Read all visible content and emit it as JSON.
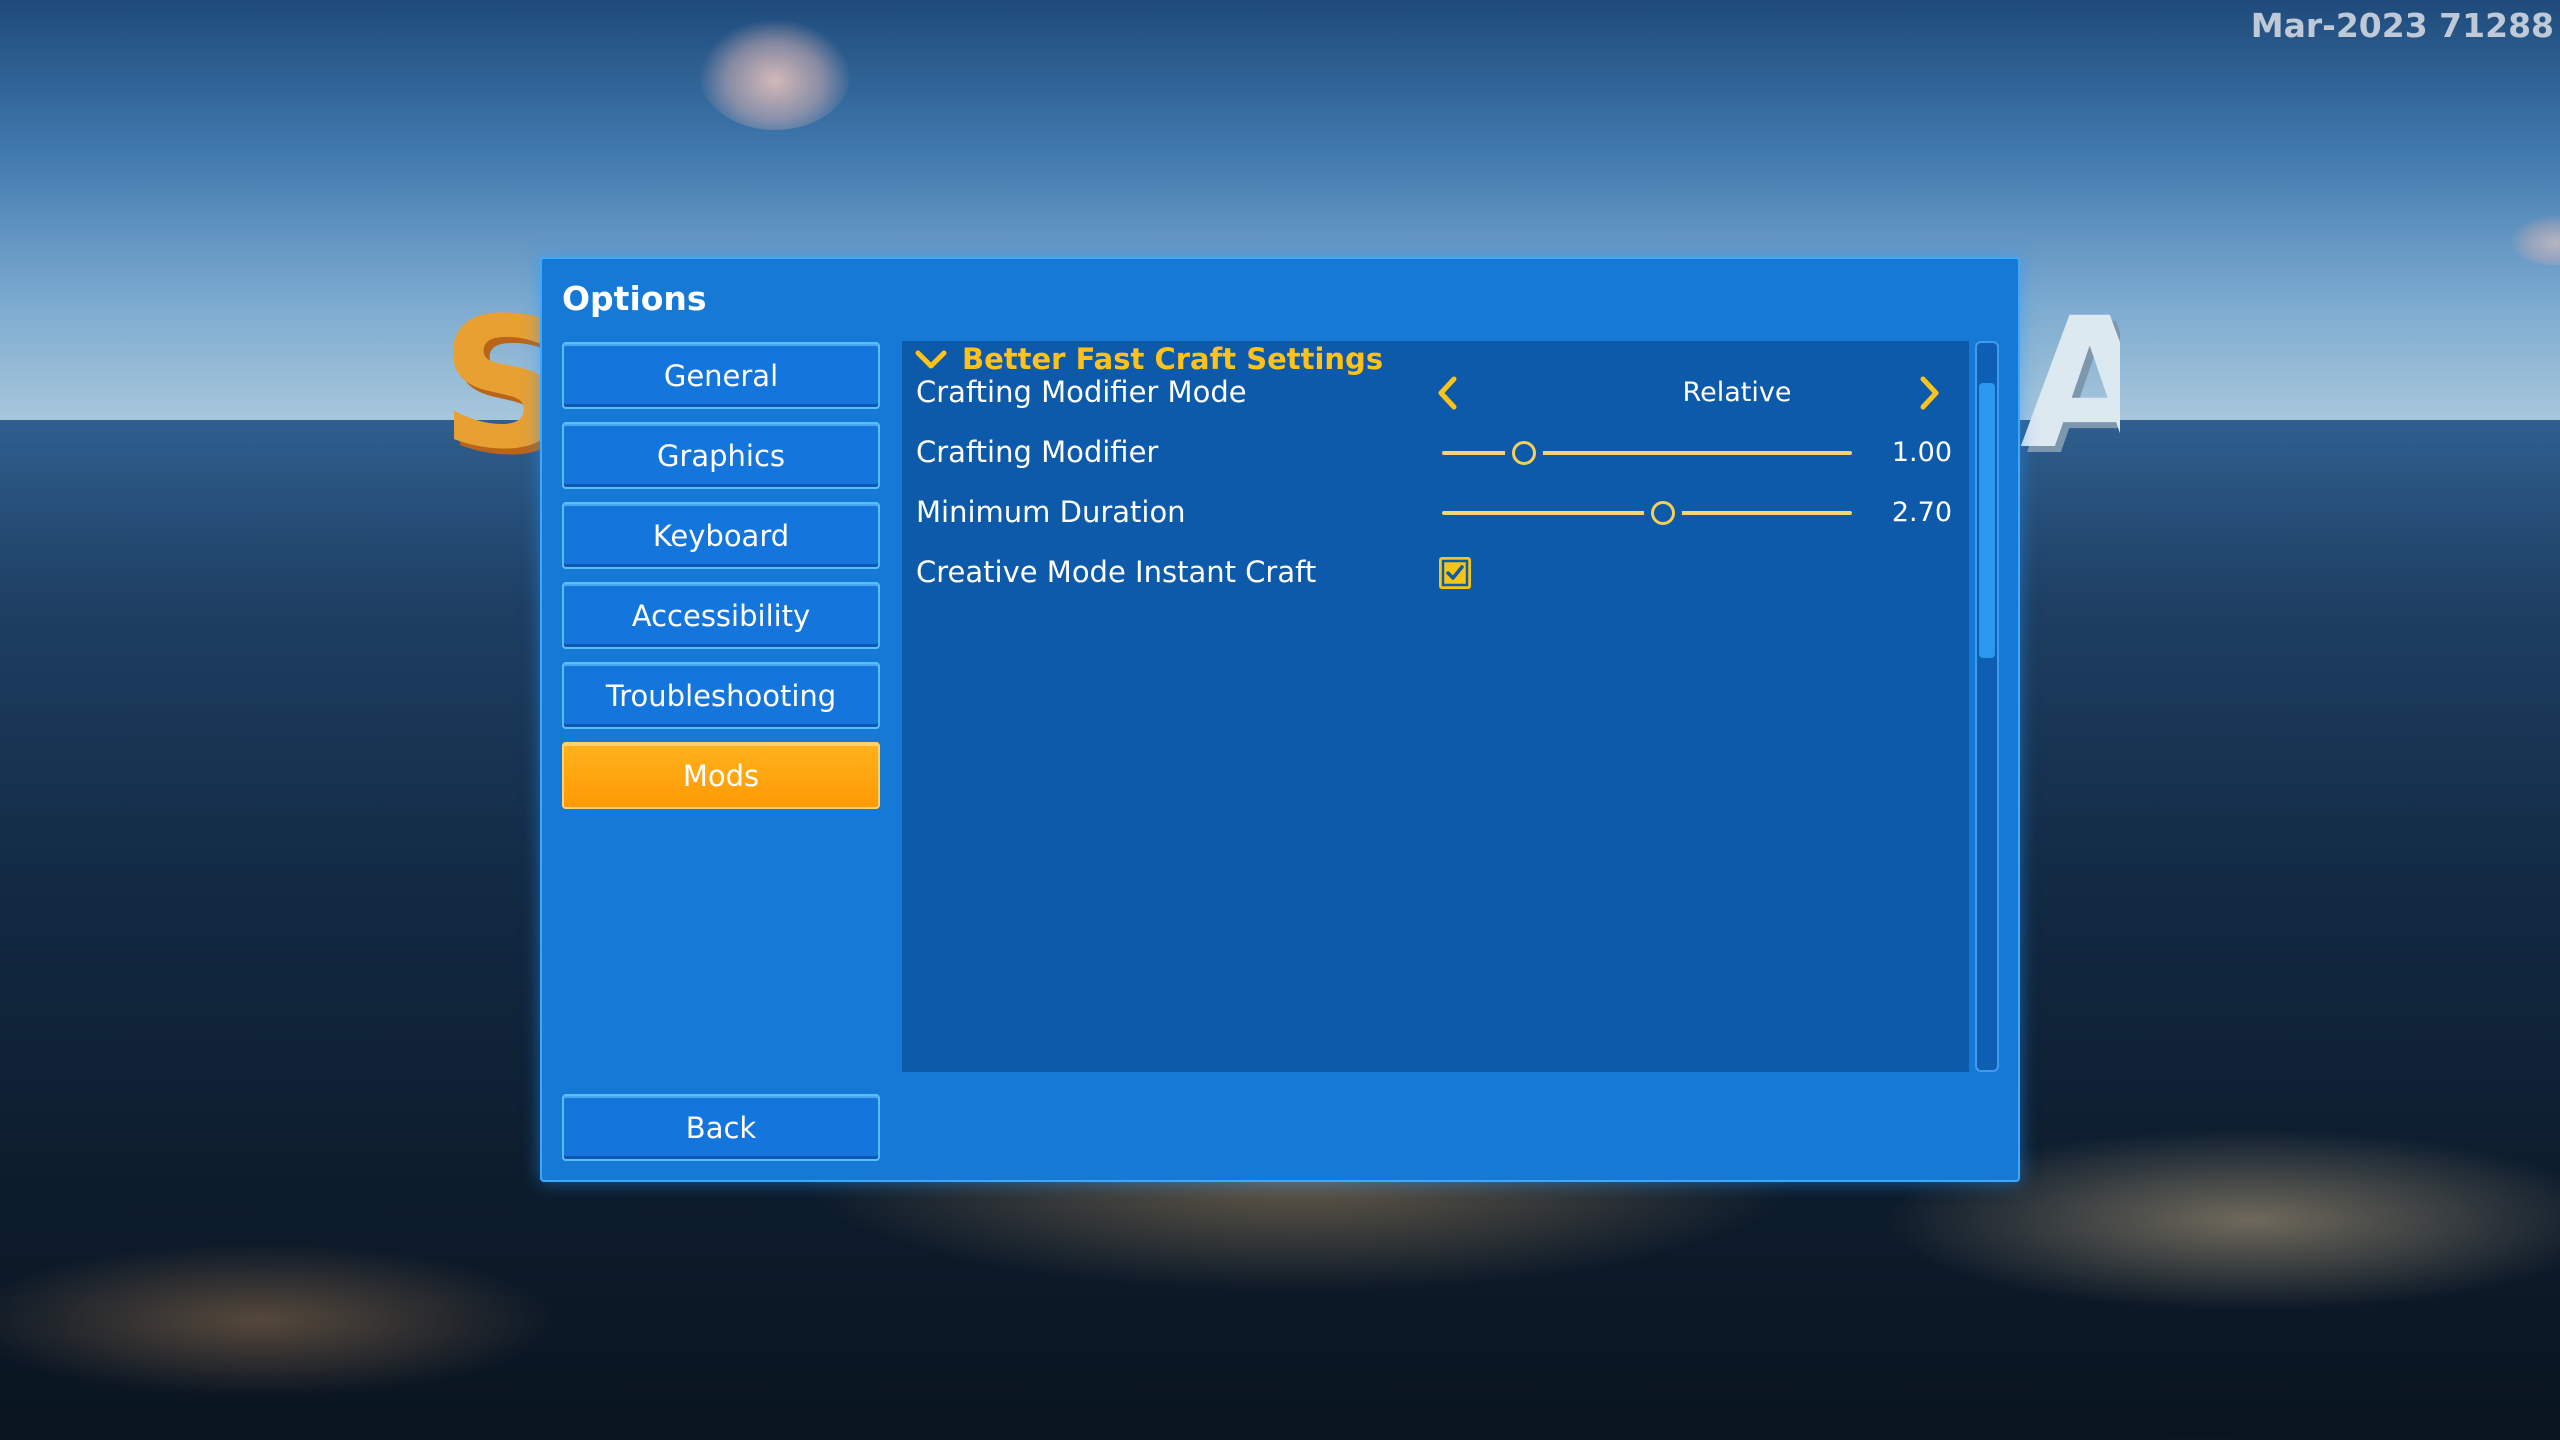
{
  "build_label": "Mar-2023 71288",
  "logo": {
    "left_fragment": "S",
    "right_fragment": "A"
  },
  "options": {
    "title": "Options",
    "nav": [
      {
        "label": "General",
        "active": false
      },
      {
        "label": "Graphics",
        "active": false
      },
      {
        "label": "Keyboard",
        "active": false
      },
      {
        "label": "Accessibility",
        "active": false
      },
      {
        "label": "Troubleshooting",
        "active": false
      },
      {
        "label": "Mods",
        "active": true
      }
    ],
    "back_label": "Back",
    "section": {
      "title": "Better Fast Craft Settings",
      "expanded": true,
      "settings": {
        "mode": {
          "label": "Crafting Modifier Mode",
          "value": "Relative"
        },
        "crafting_modifier": {
          "label": "Crafting Modifier",
          "value": "1.00",
          "fraction": 0.2
        },
        "minimum_duration": {
          "label": "Minimum Duration",
          "value": "2.70",
          "fraction": 0.54
        },
        "instant_craft": {
          "label": "Creative Mode Instant Craft",
          "checked": true
        }
      }
    }
  },
  "colors": {
    "panel": "#1779d6",
    "content": "#0d5aaa",
    "accent": "#ffc21a",
    "active_tab": "#ff9f0a"
  },
  "icons": {
    "section_toggle": "chevron-down-icon",
    "prev": "chevron-left-icon",
    "next": "chevron-right-icon",
    "checkbox": "checkmark-icon"
  }
}
